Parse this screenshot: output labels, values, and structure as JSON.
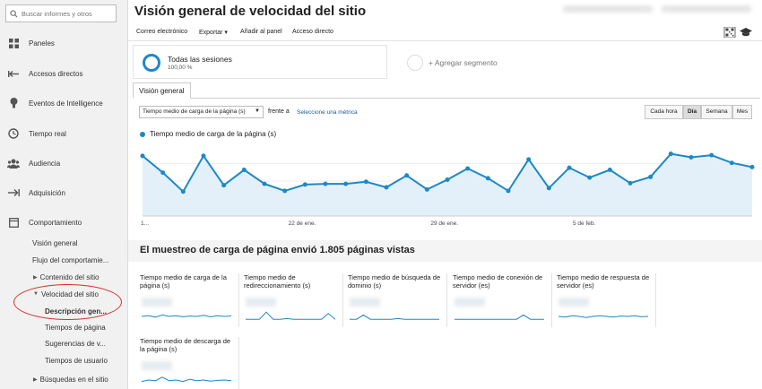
{
  "sidebar": {
    "search_placeholder": "Buscar informes y otros",
    "nav": [
      {
        "label": "Paneles",
        "icon": "grid-icon"
      },
      {
        "label": "Accesos directos",
        "icon": "shortcut-arrow-icon"
      },
      {
        "label": "Eventos de Intelligence",
        "icon": "lightbulb-icon"
      },
      {
        "label": "Tiempo real",
        "icon": "clock-icon"
      },
      {
        "label": "Audiencia",
        "icon": "people-icon"
      },
      {
        "label": "Adquisición",
        "icon": "acquisition-arrow-icon"
      },
      {
        "label": "Comportamiento",
        "icon": "behavior-window-icon"
      }
    ],
    "sub": [
      "Visión general",
      "Flujo del comportamie...",
      "Contenido del sitio",
      "Velocidad del sitio",
      "Descripción gen...",
      "Tiempos de página",
      "Sugerencias de v...",
      "Tiempos de usuario",
      "Búsquedas en el sitio"
    ]
  },
  "header": {
    "title": "Visión general de velocidad del sitio"
  },
  "toolbar": {
    "email": "Correo electrónico",
    "export": "Exportar",
    "add_dashboard": "Añadir al panel",
    "shortcut": "Acceso directo"
  },
  "segments": {
    "current_name": "Todas las sesiones",
    "current_pct": "100,00 %",
    "add_label": "+ Agregar segmento"
  },
  "tabs": {
    "overview": "Visión general"
  },
  "controls": {
    "metric": "Tiempo medio de carga de la página (s)",
    "vs": "frente a",
    "select_metric": "Seleccione una métrica",
    "granularity": [
      "Cada hora",
      "Día",
      "Semana",
      "Mes"
    ]
  },
  "chart_data": {
    "type": "line",
    "series": [
      {
        "name": "Tiempo medio de carga de la página (s)",
        "values": [
          0.86,
          0.62,
          0.35,
          0.86,
          0.44,
          0.66,
          0.46,
          0.36,
          0.45,
          0.46,
          0.46,
          0.49,
          0.41,
          0.58,
          0.38,
          0.52,
          0.68,
          0.54,
          0.36,
          0.81,
          0.4,
          0.69,
          0.55,
          0.66,
          0.47,
          0.56,
          0.89,
          0.84,
          0.87,
          0.76,
          0.7
        ]
      }
    ],
    "x_tick_labels": [
      "1...",
      "22 de ene.",
      "29 de ene.",
      "5 de feb."
    ],
    "ylim": [
      0,
      1
    ],
    "grid": true,
    "legend": "top-left"
  },
  "sampling": {
    "text": "El muestreo de carga de página envió 1.805 páginas vistas"
  },
  "cards": [
    {
      "title": "Tiempo medio de carga de la página (s)",
      "spark": [
        0.5,
        0.55,
        0.45,
        0.6,
        0.5,
        0.55,
        0.48,
        0.52,
        0.5,
        0.58,
        0.47,
        0.55,
        0.5,
        0.53
      ]
    },
    {
      "title": "Tiempo medio de redireccionamiento (s)",
      "spark": [
        0.3,
        0.3,
        0.3,
        0.8,
        0.3,
        0.3,
        0.35,
        0.3,
        0.3,
        0.3,
        0.3,
        0.3,
        0.7,
        0.3
      ]
    },
    {
      "title": "Tiempo medio de búsqueda de dominio (s)",
      "spark": [
        0.3,
        0.3,
        0.6,
        0.3,
        0.3,
        0.3,
        0.3,
        0.35,
        0.3,
        0.3,
        0.3,
        0.3,
        0.3,
        0.3
      ]
    },
    {
      "title": "Tiempo medio de conexión de servidor (es)",
      "spark": [
        0.3,
        0.3,
        0.3,
        0.3,
        0.3,
        0.3,
        0.3,
        0.3,
        0.3,
        0.3,
        0.6,
        0.3,
        0.3,
        0.3
      ]
    },
    {
      "title": "Tiempo medio de respuesta de servidor (es)",
      "spark": [
        0.5,
        0.45,
        0.55,
        0.5,
        0.42,
        0.5,
        0.55,
        0.5,
        0.45,
        0.52,
        0.5,
        0.55,
        0.48,
        0.5
      ]
    },
    {
      "title": "Tiempo medio de descarga de la página (s)",
      "spark": [
        0.4,
        0.5,
        0.45,
        0.7,
        0.45,
        0.5,
        0.4,
        0.55,
        0.45,
        0.5,
        0.42,
        0.48,
        0.5,
        0.45
      ]
    }
  ]
}
